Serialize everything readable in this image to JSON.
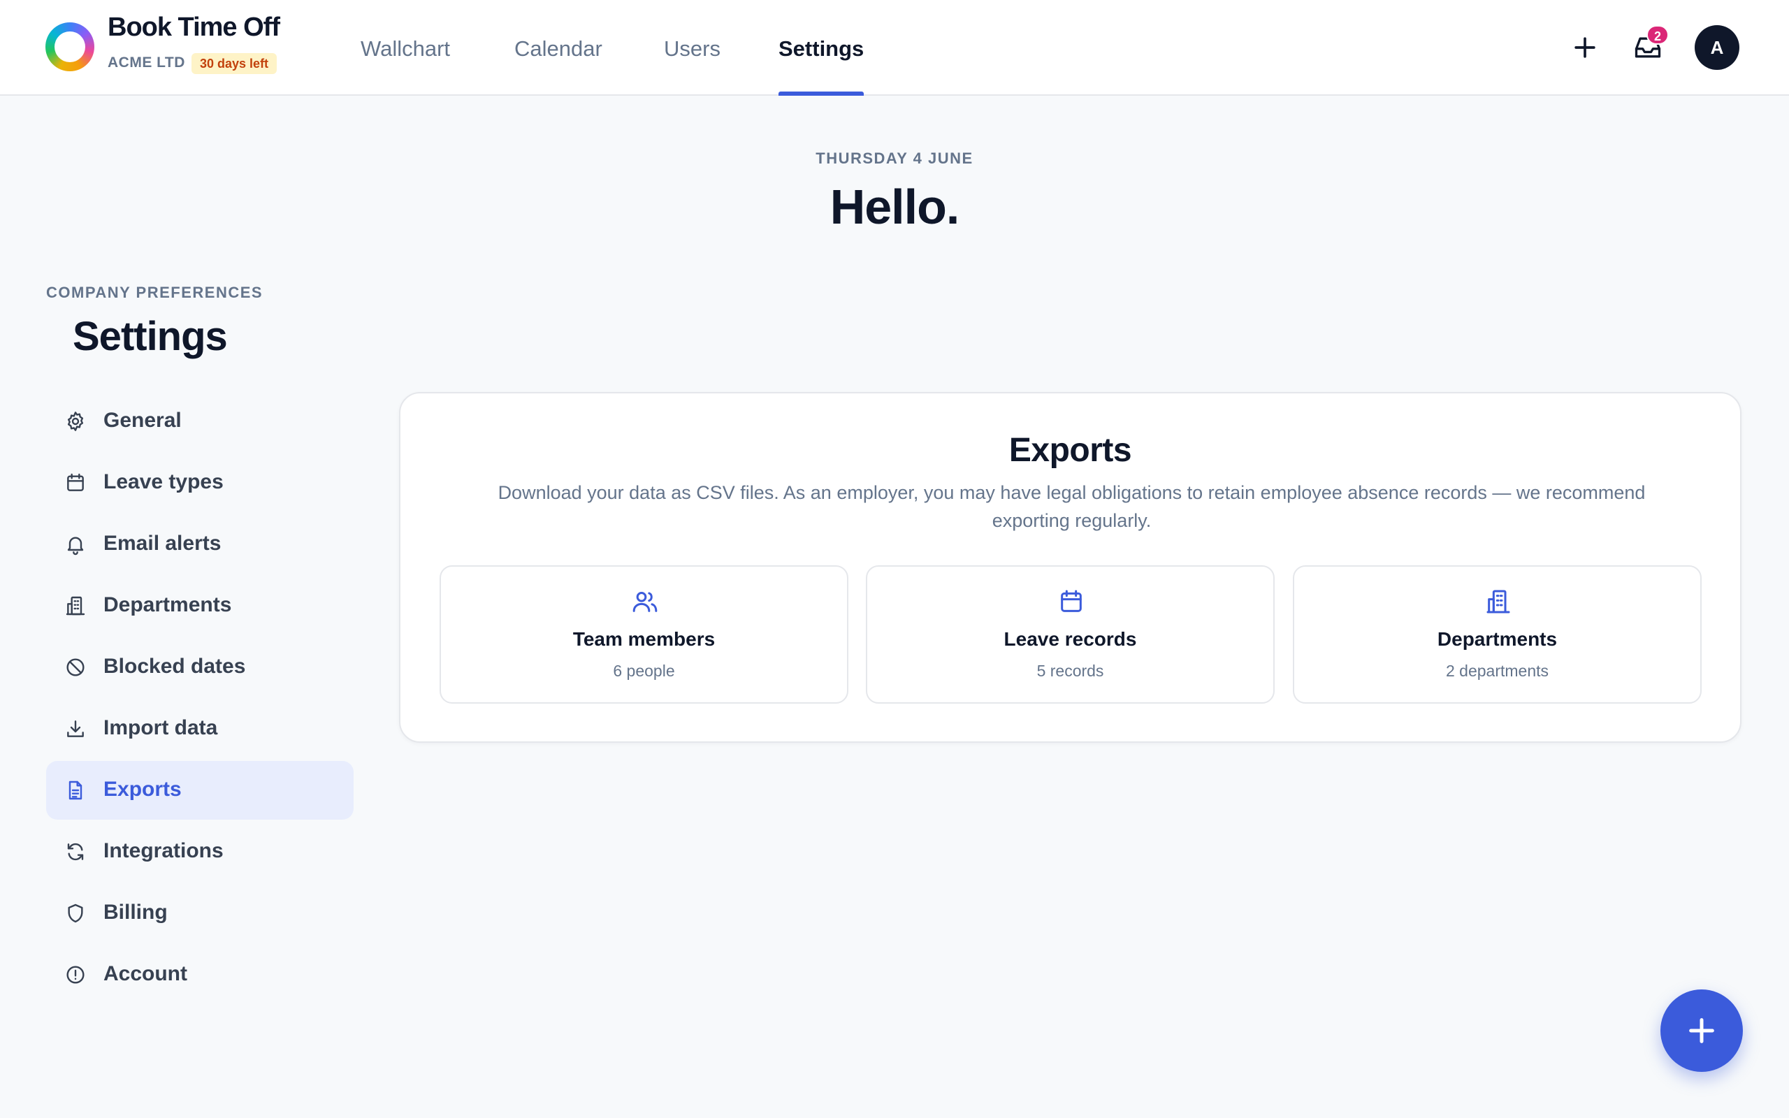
{
  "header": {
    "brand_title": "Book Time Off",
    "company": "ACME LTD",
    "trial_badge": "30 days left",
    "nav": [
      {
        "label": "Wallchart",
        "active": false
      },
      {
        "label": "Calendar",
        "active": false
      },
      {
        "label": "Users",
        "active": false
      },
      {
        "label": "Settings",
        "active": true
      }
    ],
    "notification_count": "2",
    "avatar_initial": "A"
  },
  "greeting": {
    "date": "THURSDAY 4 JUNE",
    "hello": "Hello."
  },
  "sidebar": {
    "caption": "COMPANY PREFERENCES",
    "title": "Settings",
    "items": [
      {
        "label": "General",
        "icon": "gear-icon",
        "active": false
      },
      {
        "label": "Leave types",
        "icon": "calendar-icon",
        "active": false
      },
      {
        "label": "Email alerts",
        "icon": "bell-icon",
        "active": false
      },
      {
        "label": "Departments",
        "icon": "building-icon",
        "active": false
      },
      {
        "label": "Blocked dates",
        "icon": "ban-icon",
        "active": false
      },
      {
        "label": "Import data",
        "icon": "download-icon",
        "active": false
      },
      {
        "label": "Exports",
        "icon": "document-icon",
        "active": true
      },
      {
        "label": "Integrations",
        "icon": "refresh-icon",
        "active": false
      },
      {
        "label": "Billing",
        "icon": "shield-icon",
        "active": false
      },
      {
        "label": "Account",
        "icon": "alert-circle-icon",
        "active": false
      }
    ]
  },
  "exports": {
    "title": "Exports",
    "description": "Download your data as CSV files. As an employer, you may have legal obligations to retain employee absence records — we recommend exporting regularly.",
    "tiles": [
      {
        "label": "Team members",
        "sub": "6 people",
        "icon": "users-icon"
      },
      {
        "label": "Leave records",
        "sub": "5 records",
        "icon": "calendar-icon"
      },
      {
        "label": "Departments",
        "sub": "2 departments",
        "icon": "building-icon"
      }
    ]
  },
  "colors": {
    "accent": "#3b5bdb",
    "text_primary": "#0f172a",
    "text_muted": "#64748b",
    "badge_bg": "#fef3c7",
    "badge_text": "#c2410c",
    "notification": "#db2777",
    "background": "#f7f9fb"
  }
}
